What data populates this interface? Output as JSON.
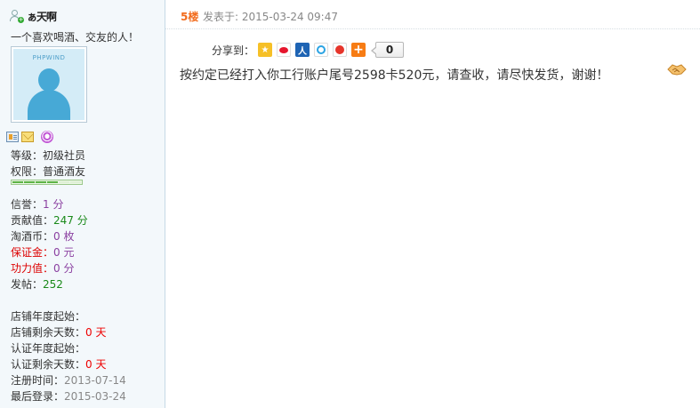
{
  "sidebar": {
    "username": "ぁ天啊",
    "signature": "一个喜欢喝酒、交友的人！",
    "avatar_brand": "PHPWIND",
    "rank_label": "等级：",
    "rank_value": "初级社员",
    "permission_label": "权限：",
    "permission_value": "普通酒友",
    "level_progress": 0.6,
    "stats": [
      {
        "label": "信誉：",
        "value": "1 分"
      },
      {
        "label": "贡献值：",
        "value": "247 分"
      },
      {
        "label": "淘酒币：",
        "value": "0 枚"
      },
      {
        "label": "保证金：",
        "value": "0 元"
      },
      {
        "label": "功力值：",
        "value": "0 分"
      },
      {
        "label": "发帖：",
        "value": "252"
      }
    ],
    "shop": [
      {
        "label": "店铺年度起始：",
        "value": ""
      },
      {
        "label": "店铺剩余天数：",
        "value": "0 天"
      },
      {
        "label": "认证年度起始：",
        "value": ""
      },
      {
        "label": "认证剩余天数：",
        "value": "0 天"
      },
      {
        "label": "注册时间：",
        "value": "2013-07-14"
      },
      {
        "label": "最后登录：",
        "value": "2015-03-24"
      }
    ],
    "colors": {
      "background": "#f3f8fb",
      "accent_red": "#e00000",
      "green": "#1a8a1a",
      "purple": "#8a3fa0"
    }
  },
  "post": {
    "floor": "5楼",
    "posted_at": "发表于: 2015-03-24 09:47",
    "share_label": "分享到：",
    "share_targets": [
      "qzone-icon",
      "weibo-icon",
      "renren-icon",
      "pengyou-icon",
      "kaixin-icon",
      "more-share-icon"
    ],
    "share_count": "0",
    "body": "按约定已经打入你工行账户尾号2598卡520元，请查收，请尽快发货，谢谢！",
    "emoticon": "handshake-icon",
    "colors": {
      "floor": "#f26c1d"
    }
  }
}
